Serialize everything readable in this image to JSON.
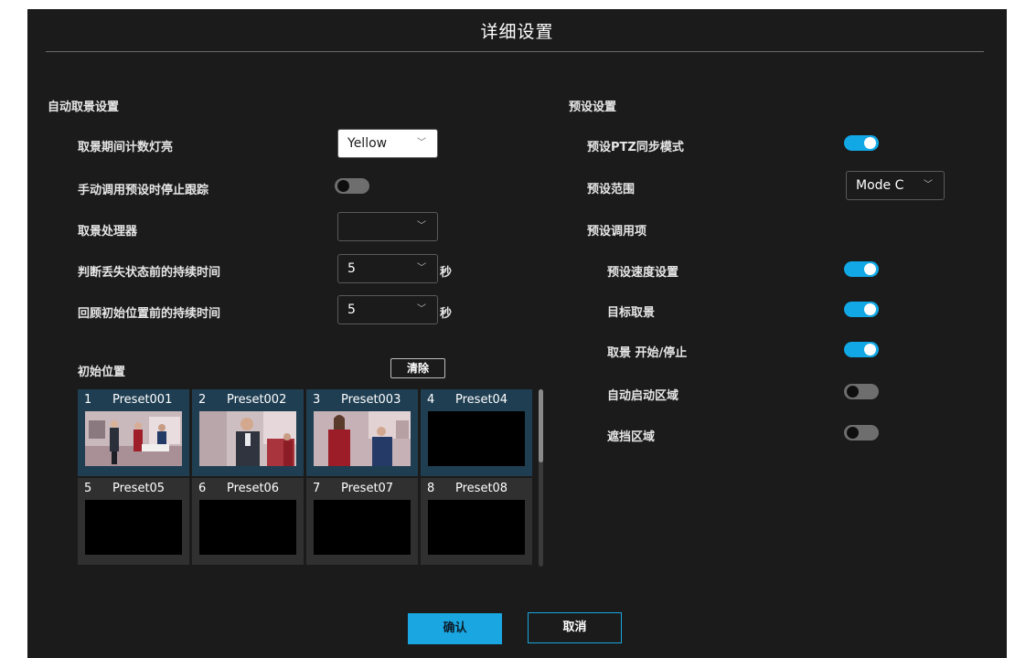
{
  "dialog": {
    "title": "详细设置"
  },
  "auto_framing": {
    "section_title": "自动取景设置",
    "rows": [
      {
        "label": "取景期间计数灯亮",
        "value": "Yellow"
      },
      {
        "label": "手动调用预设时停止跟踪",
        "toggle": false
      },
      {
        "label": "取景处理器",
        "value": ""
      },
      {
        "label": "判断丢失状态前的持续时间",
        "value": "5",
        "unit": "秒"
      },
      {
        "label": "回顾初始位置前的持续时间",
        "value": "5",
        "unit": "秒"
      }
    ]
  },
  "initial_position": {
    "title": "初始位置",
    "clear_label": "清除",
    "presets": [
      {
        "num": "1",
        "name": "Preset001",
        "has_image": true,
        "selected": true
      },
      {
        "num": "2",
        "name": "Preset002",
        "has_image": true,
        "selected": true
      },
      {
        "num": "3",
        "name": "Preset003",
        "has_image": true,
        "selected": true
      },
      {
        "num": "4",
        "name": "Preset04",
        "has_image": false,
        "selected": true
      },
      {
        "num": "5",
        "name": "Preset05",
        "has_image": false,
        "selected": false
      },
      {
        "num": "6",
        "name": "Preset06",
        "has_image": false,
        "selected": false
      },
      {
        "num": "7",
        "name": "Preset07",
        "has_image": false,
        "selected": false
      },
      {
        "num": "8",
        "name": "Preset08",
        "has_image": false,
        "selected": false
      }
    ]
  },
  "preset_settings": {
    "section_title": "预设设置",
    "ptz_sync": {
      "label": "预设PTZ同步模式",
      "toggle": true
    },
    "range": {
      "label": "预设范围",
      "value": "Mode C"
    },
    "recall_items_label": "预设调用项",
    "recall_items": [
      {
        "label": "预设速度设置",
        "toggle": true
      },
      {
        "label": "目标取景",
        "toggle": true
      },
      {
        "label": "取景 开始/停止",
        "toggle": true
      },
      {
        "label": "自动启动区域",
        "toggle": false
      },
      {
        "label": "遮挡区域",
        "toggle": false
      }
    ]
  },
  "footer": {
    "confirm_label": "确认",
    "cancel_label": "取消"
  },
  "colors": {
    "accent": "#1aa6e0",
    "background": "#1b1b1b",
    "toggle_off": "#6e6e6e"
  }
}
